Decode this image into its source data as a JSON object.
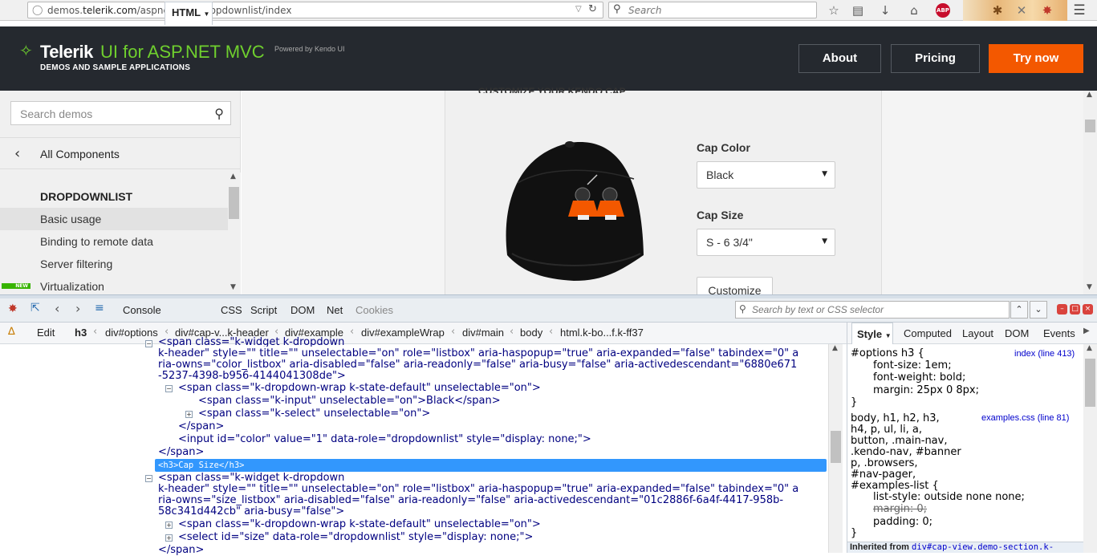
{
  "browser": {
    "url_prefix": "demos.",
    "url_domain": "telerik.com",
    "url_path": "/aspnet-mvc/dropdownlist/index",
    "search_placeholder": "Search",
    "abp_label": "ABP"
  },
  "site": {
    "brand": "Telerik",
    "product": "UI for ASP.NET MVC",
    "powered_by": "Powered by Kendo UI",
    "subtitle": "DEMOS AND SAMPLE APPLICATIONS",
    "nav": {
      "about": "About",
      "pricing": "Pricing",
      "try": "Try now"
    },
    "accent": "#f35800",
    "logo_color": "#6fcf2e"
  },
  "sidebar": {
    "search_placeholder": "Search demos",
    "all_components": "All Components",
    "section": "DROPDOWNLIST",
    "items": [
      {
        "label": "Basic usage",
        "active": true
      },
      {
        "label": "Binding to remote data",
        "active": false
      },
      {
        "label": "Server filtering",
        "active": false
      },
      {
        "label": "Virtualization",
        "active": false
      }
    ],
    "new_badge": "NEW"
  },
  "demo": {
    "heading": "CUSTOMIZE YOUR KENDO CAP",
    "cap_color_label": "Cap Color",
    "cap_color_value": "Black",
    "cap_size_label": "Cap Size",
    "cap_size_value": "S - 6 3/4\"",
    "customize_button": "Customize"
  },
  "firebug": {
    "tabs": [
      "Console",
      "HTML",
      "CSS",
      "Script",
      "DOM",
      "Net",
      "Cookies"
    ],
    "active_tab": "HTML",
    "search_placeholder": "Search by text or CSS selector",
    "edit_label": "Edit",
    "breadcrumbs": [
      "h3",
      "div#options",
      "div#cap-v...k-header",
      "div#example",
      "div#exampleWrap",
      "div#main",
      "body",
      "html.k-bo...f.k-ff37"
    ],
    "right_tabs": [
      "Style",
      "Computed",
      "Layout",
      "DOM",
      "Events"
    ],
    "html_lines": {
      "l0": "<span class=\"k-widget k-dropdown",
      "l1": "k-header\" style=\"\" title=\"\" unselectable=\"on\" role=\"listbox\" aria-haspopup=\"true\" aria-expanded=\"false\" tabindex=\"0\" a",
      "l2": "ria-owns=\"color_listbox\" aria-disabled=\"false\" aria-readonly=\"false\" aria-busy=\"false\" aria-activedescendant=\"6880e671",
      "l3": "-5237-4398-b956-4144041308de\">",
      "l4": "<span class=\"k-dropdown-wrap k-state-default\" unselectable=\"on\">",
      "l5": "<span class=\"k-input\" unselectable=\"on\">Black</span>",
      "l6": "<span class=\"k-select\" unselectable=\"on\">",
      "l7": "</span>",
      "l8": "<input id=\"color\" value=\"1\" data-role=\"dropdownlist\" style=\"display: none;\">",
      "l9": "</span>",
      "sel": "<h3>Cap Size</h3>",
      "l10": "<span class=\"k-widget k-dropdown",
      "l11": "k-header\" style=\"\" title=\"\" unselectable=\"on\" role=\"listbox\" aria-haspopup=\"true\" aria-expanded=\"false\" tabindex=\"0\" a",
      "l12": "ria-owns=\"size_listbox\" aria-disabled=\"false\" aria-readonly=\"false\" aria-activedescendant=\"01c2886f-6a4f-4417-958b-",
      "l13": "58c341d442cb\" aria-busy=\"false\">",
      "l14": "<span class=\"k-dropdown-wrap k-state-default\" unselectable=\"on\">",
      "l15": "<select id=\"size\" data-role=\"dropdownlist\" style=\"display: none;\">",
      "l16": "</span>"
    },
    "style_rules": {
      "r1_selector": "#options h3 {",
      "r1_source": "index (line 413)",
      "r1_p1": "font-size: 1em;",
      "r1_p2": "font-weight: bold;",
      "r1_p3": "margin: 25px 0 8px;",
      "r1_close": "}",
      "r2_sel1": "body, h1, h2, h3,",
      "r2_source": "examples.css (line 81)",
      "r2_sel2": "h4, p, ul, li, a,",
      "r2_sel3": "button, .main-nav,",
      "r2_sel4": ".kendo-nav, #banner",
      "r2_sel5": "p, .browsers,",
      "r2_sel6": "#nav-pager,",
      "r2_sel7": "#examples-list {",
      "r2_p1": "list-style: outside none none;",
      "r2_p2": "margin: 0;",
      "r2_p3": "padding: 0;",
      "r2_close": "}",
      "inherited_label": "Inherited from",
      "inherited_target": "div#cap-view.demo-section.k-"
    }
  }
}
